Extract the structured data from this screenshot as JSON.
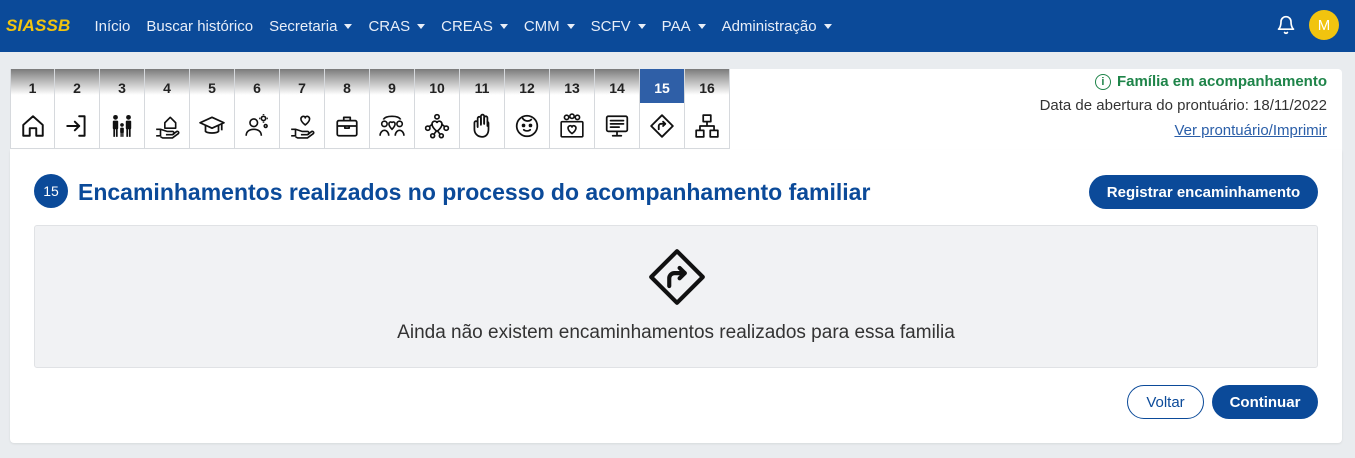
{
  "navbar": {
    "brand": "SIASSB",
    "items": [
      {
        "label": "Início",
        "dropdown": false
      },
      {
        "label": "Buscar histórico",
        "dropdown": false
      },
      {
        "label": "Secretaria",
        "dropdown": true
      },
      {
        "label": "CRAS",
        "dropdown": true
      },
      {
        "label": "CREAS",
        "dropdown": true
      },
      {
        "label": "CMM",
        "dropdown": true
      },
      {
        "label": "SCFV",
        "dropdown": true
      },
      {
        "label": "PAA",
        "dropdown": true
      },
      {
        "label": "Administração",
        "dropdown": true
      }
    ],
    "notification_icon": "bell-icon",
    "avatar_initial": "M",
    "colors": {
      "bar": "#0b4a99",
      "brand": "#f1c40f",
      "avatar": "#f1c40f"
    }
  },
  "steps": [
    {
      "number": "1",
      "icon": "home-icon"
    },
    {
      "number": "2",
      "icon": "enter-icon"
    },
    {
      "number": "3",
      "icon": "family-icon"
    },
    {
      "number": "4",
      "icon": "hand-house-icon"
    },
    {
      "number": "5",
      "icon": "graduation-cap-icon"
    },
    {
      "number": "6",
      "icon": "person-ideas-icon"
    },
    {
      "number": "7",
      "icon": "hand-heart-icon"
    },
    {
      "number": "8",
      "icon": "briefcase-icon"
    },
    {
      "number": "9",
      "icon": "group-heart-icon"
    },
    {
      "number": "10",
      "icon": "network-heart-icon"
    },
    {
      "number": "11",
      "icon": "hand-stop-icon"
    },
    {
      "number": "12",
      "icon": "child-face-icon"
    },
    {
      "number": "13",
      "icon": "community-box-icon"
    },
    {
      "number": "14",
      "icon": "list-board-icon"
    },
    {
      "number": "15",
      "icon": "direction-sign-icon",
      "active": true
    },
    {
      "number": "16",
      "icon": "org-chart-icon"
    }
  ],
  "status": {
    "label": "Família em acompanhamento",
    "open_date": "Data de abertura do prontuário: 18/11/2022",
    "link": "Ver prontuário/Imprimir",
    "color": "#1e8449"
  },
  "section": {
    "number": "15",
    "title": "Encaminhamentos realizados no processo do acompanhamento familiar",
    "register_button": "Registrar encaminhamento",
    "empty_icon": "direction-sign-icon",
    "empty_message": "Ainda não existem encaminhamentos realizados para essa familia",
    "back_button": "Voltar",
    "continue_button": "Continuar"
  }
}
